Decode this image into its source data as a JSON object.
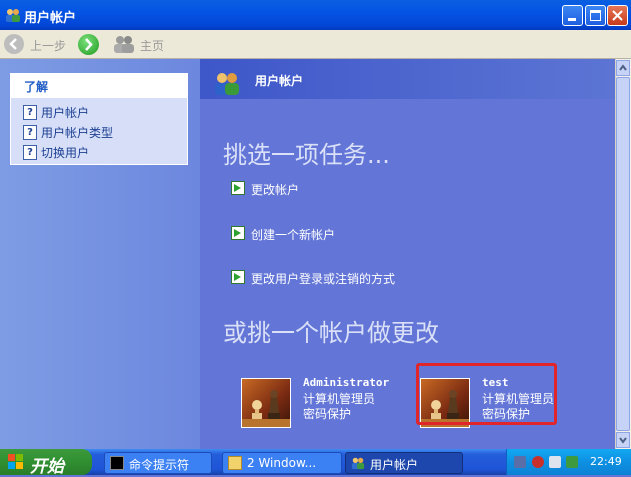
{
  "window": {
    "title": "用户帐户"
  },
  "toolbar": {
    "back_label": "上一步",
    "home_label": "主页"
  },
  "left_pane": {
    "header": "了解",
    "items": [
      {
        "label": "用户帐户"
      },
      {
        "label": "用户帐户类型"
      },
      {
        "label": "切换用户"
      }
    ]
  },
  "main": {
    "header": "用户帐户",
    "pick_task_heading": "挑选一项任务...",
    "tasks": [
      {
        "label": "更改帐户"
      },
      {
        "label": "创建一个新帐户"
      },
      {
        "label": "更改用户登录或注销的方式"
      }
    ],
    "pick_account_heading": "或挑一个帐户做更改",
    "accounts": [
      {
        "name": "Administrator",
        "line1": "计算机管理员",
        "line2": "密码保护"
      },
      {
        "name": "test",
        "line1": "计算机管理员",
        "line2": "密码保护"
      }
    ]
  },
  "taskbar": {
    "start_label": "开始",
    "buttons": [
      {
        "label": "命令提示符"
      },
      {
        "label": "2 Window..."
      },
      {
        "label": "用户帐户"
      }
    ],
    "clock": "22:49"
  },
  "colors": {
    "title_bar": "#0454E4",
    "highlight": "#E0252B",
    "start": "#308F30"
  }
}
